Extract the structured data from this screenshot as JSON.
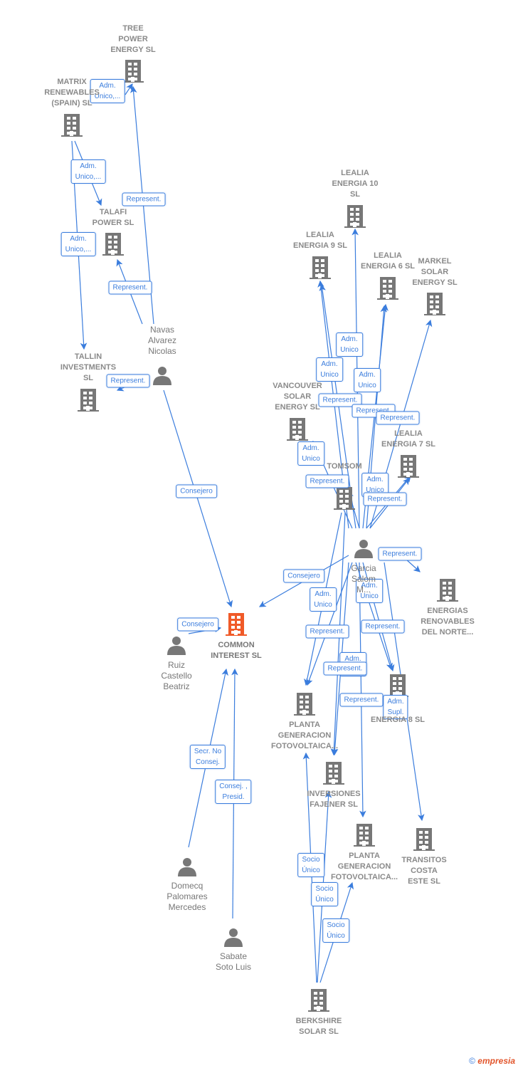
{
  "colors": {
    "edge": "#3b7ddd",
    "node": "#777777",
    "focus": "#f05a28"
  },
  "nodes": [
    {
      "id": "tree",
      "type": "company",
      "label": "TREE\nPOWER\nENERGY  SL"
    },
    {
      "id": "matrix",
      "type": "company",
      "label": "MATRIX\nRENEWABLES\n(SPAIN)  SL"
    },
    {
      "id": "talafi",
      "type": "company",
      "label": "TALAFI\nPOWER  SL"
    },
    {
      "id": "tallin",
      "type": "company",
      "label": "TALLIN\nINVESTMENTS\nSL"
    },
    {
      "id": "navas",
      "type": "person",
      "label": "Navas\nAlvarez\nNicolas"
    },
    {
      "id": "lealia10",
      "type": "company",
      "label": "LEALIA\nENERGIA 10\nSL"
    },
    {
      "id": "lealia9",
      "type": "company",
      "label": "LEALIA\nENERGIA 9  SL"
    },
    {
      "id": "lealia6",
      "type": "company",
      "label": "LEALIA\nENERGIA 6  SL"
    },
    {
      "id": "markel",
      "type": "company",
      "label": "MARKEL\nSOLAR\nENERGY  SL"
    },
    {
      "id": "vancouver",
      "type": "company",
      "label": "VANCOUVER\nSOLAR\nENERGY  SL"
    },
    {
      "id": "lealia7",
      "type": "company",
      "label": "LEALIA\nENERGIA 7  SL"
    },
    {
      "id": "tomsom",
      "type": "company",
      "label": "TOMSOM"
    },
    {
      "id": "garcia",
      "type": "person",
      "label": "Garcia\nSalom\nM..."
    },
    {
      "id": "energias",
      "type": "company",
      "label": "ENERGIAS\nRENOVABLES\nDEL NORTE..."
    },
    {
      "id": "common",
      "type": "focus",
      "label": "COMMON\nINTEREST  SL"
    },
    {
      "id": "ruiz",
      "type": "person",
      "label": "Ruiz\nCastello\nBeatriz"
    },
    {
      "id": "energia8",
      "type": "company",
      "label": "ENERGIA 8  SL"
    },
    {
      "id": "planta1",
      "type": "company",
      "label": "PLANTA\nGENERACION\nFOTOVOLTAICA..."
    },
    {
      "id": "inversiones",
      "type": "company",
      "label": "INVERSIONES\nFAJENER  SL"
    },
    {
      "id": "planta2",
      "type": "company",
      "label": "PLANTA\nGENERACION\nFOTOVOLTAICA..."
    },
    {
      "id": "transitos",
      "type": "company",
      "label": "TRANSITOS\nCOSTA\nESTE SL"
    },
    {
      "id": "domecq",
      "type": "person",
      "label": "Domecq\nPalomares\nMercedes"
    },
    {
      "id": "sabate",
      "type": "person",
      "label": "Sabate\nSoto Luis"
    },
    {
      "id": "berkshire",
      "type": "company",
      "label": "BERKSHIRE\nSOLAR  SL"
    }
  ],
  "edges": [
    {
      "from": "matrix",
      "to": "tree",
      "label": "Adm.\nUnico,..."
    },
    {
      "from": "matrix",
      "to": "talafi",
      "label": "Adm.\nUnico,..."
    },
    {
      "from": "navas",
      "to": "talafi",
      "label": "Represent."
    },
    {
      "from": "navas",
      "to": "tree",
      "label": "Represent."
    },
    {
      "from": "matrix",
      "to": "tallin",
      "label": "Adm.\nUnico,..."
    },
    {
      "from": "navas",
      "to": "tallin",
      "label": "Represent."
    },
    {
      "from": "navas",
      "to": "common",
      "label": "Consejero"
    },
    {
      "from": "ruiz",
      "to": "common",
      "label": "Consejero"
    },
    {
      "from": "domecq",
      "to": "common",
      "label": "Secr.  No\nConsej."
    },
    {
      "from": "sabate",
      "to": "common",
      "label": "Consej. ,\nPresid."
    },
    {
      "from": "garcia",
      "to": "common",
      "label": "Consejero"
    },
    {
      "from": "garcia",
      "to": "energias",
      "label": "Represent."
    },
    {
      "from": "tomsom",
      "to": "lealia10",
      "label": "Adm.\nUnico"
    },
    {
      "from": "tomsom",
      "to": "lealia9",
      "label": "Adm.\nUnico"
    },
    {
      "from": "tomsom",
      "to": "lealia6",
      "label": "Adm.\nUnico"
    },
    {
      "from": "garcia",
      "to": "lealia9",
      "label": "Represent."
    },
    {
      "from": "garcia",
      "to": "lealia6",
      "label": "Represent."
    },
    {
      "from": "garcia",
      "to": "markel",
      "label": "Represent."
    },
    {
      "from": "garcia",
      "to": "vancouver",
      "label": "Adm.\nUnico"
    },
    {
      "from": "garcia",
      "to": "tomsom",
      "label": "Represent."
    },
    {
      "from": "tomsom",
      "to": "lealia7",
      "label": "Adm.\nUnico"
    },
    {
      "from": "garcia",
      "to": "lealia7",
      "label": "Represent."
    },
    {
      "from": "tomsom",
      "to": "planta1",
      "label": "Adm.\nUnico"
    },
    {
      "from": "tomsom",
      "to": "energia8",
      "label": "Adm.\nUnico"
    },
    {
      "from": "garcia",
      "to": "planta1",
      "label": "Represent."
    },
    {
      "from": "garcia",
      "to": "energia8",
      "label": "Represent."
    },
    {
      "from": "tomsom",
      "to": "inversiones",
      "label": "Adm.\nUnico"
    },
    {
      "from": "garcia",
      "to": "inversiones",
      "label": "Represent."
    },
    {
      "from": "garcia",
      "to": "planta2",
      "label": "Represent."
    },
    {
      "from": "tomsom",
      "to": "transitos",
      "label": "Adm.\nSupl."
    },
    {
      "from": "berkshire",
      "to": "planta1",
      "label": "Socio\nÚnico"
    },
    {
      "from": "berkshire",
      "to": "inversiones",
      "label": "Socio\nÚnico"
    },
    {
      "from": "berkshire",
      "to": "planta2",
      "label": "Socio\nÚnico"
    }
  ],
  "footer": {
    "copyright": "©",
    "brand": "empresia"
  }
}
